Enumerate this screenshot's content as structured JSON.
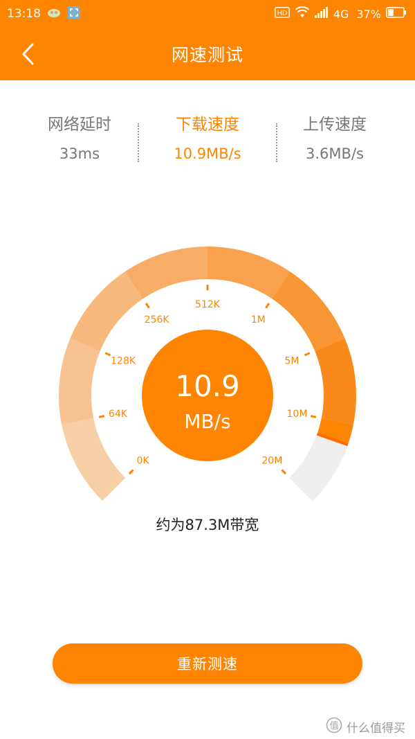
{
  "status_bar": {
    "time": "13:18",
    "hd": "HD",
    "network": "4G",
    "battery": "37%",
    "battery_level": 0.37
  },
  "header": {
    "title": "网速测试"
  },
  "stats": [
    {
      "label": "网络延时",
      "value": "33ms"
    },
    {
      "label": "下载速度",
      "value": "10.9MB/s"
    },
    {
      "label": "上传速度",
      "value": "3.6MB/s"
    }
  ],
  "gauge": {
    "value": "10.9",
    "unit": "MB/s",
    "ticks": [
      "0K",
      "64K",
      "128K",
      "256K",
      "512K",
      "1M",
      "5M",
      "10M",
      "20M"
    ],
    "progress_fraction": 0.905,
    "colors": {
      "accent": "#fd8502",
      "track_empty": "#efefef"
    }
  },
  "bandwidth_text": "约为87.3M带宽",
  "retest_label": "重新测速",
  "watermark": "什么值得买",
  "icons": {
    "back": "chevron-left-icon",
    "watermark": "smzdm-logo-icon"
  }
}
